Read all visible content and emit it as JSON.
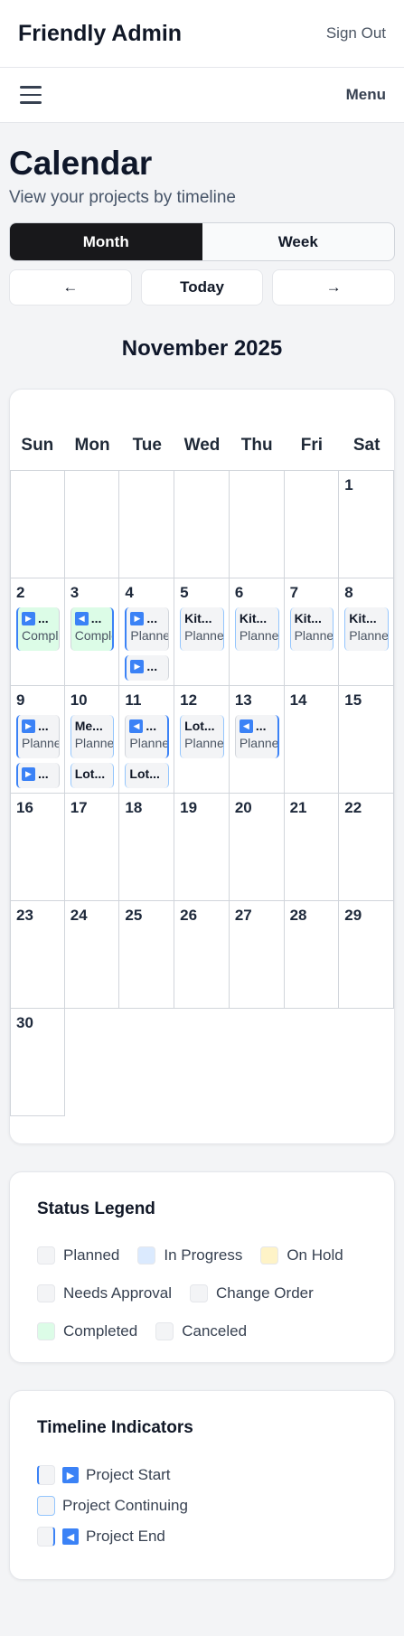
{
  "header": {
    "brand": "Friendly Admin",
    "sign_out": "Sign Out"
  },
  "menubar": {
    "menu_label": "Menu",
    "hamburger_icon": "hamburger-icon"
  },
  "page": {
    "title": "Calendar",
    "subtitle": "View your projects by timeline"
  },
  "view_toggle": {
    "month": "Month",
    "week": "Week",
    "active": "month"
  },
  "nav": {
    "prev": "←",
    "today": "Today",
    "next": "→"
  },
  "calendar": {
    "month_title": "November 2025",
    "weekdays": [
      "Sun",
      "Mon",
      "Tue",
      "Wed",
      "Thu",
      "Fri",
      "Sat"
    ],
    "leading_blank_days": 6,
    "days": [
      {
        "num": "1",
        "events": []
      },
      {
        "num": "2",
        "events": [
          {
            "title": "...",
            "status": "Completed",
            "kind": "start",
            "color": "completed"
          }
        ]
      },
      {
        "num": "3",
        "events": [
          {
            "title": "...",
            "status": "Completed",
            "kind": "end",
            "color": "completed"
          }
        ]
      },
      {
        "num": "4",
        "events": [
          {
            "title": "...",
            "status": "Planned",
            "kind": "start",
            "color": "planned"
          },
          {
            "title": "...",
            "status": "",
            "kind": "start",
            "color": "planned",
            "small": true
          }
        ]
      },
      {
        "num": "5",
        "events": [
          {
            "title": "Kit...",
            "status": "Planned",
            "kind": "cont",
            "color": "planned"
          }
        ]
      },
      {
        "num": "6",
        "events": [
          {
            "title": "Kit...",
            "status": "Planned",
            "kind": "cont",
            "color": "planned"
          }
        ]
      },
      {
        "num": "7",
        "events": [
          {
            "title": "Kit...",
            "status": "Planned",
            "kind": "cont",
            "color": "planned"
          }
        ]
      },
      {
        "num": "8",
        "events": [
          {
            "title": "Kit...",
            "status": "Planned",
            "kind": "cont",
            "color": "planned"
          }
        ]
      },
      {
        "num": "9",
        "events": [
          {
            "title": "...",
            "status": "Planned",
            "kind": "start",
            "color": "planned"
          },
          {
            "title": "...",
            "status": "",
            "kind": "start",
            "color": "planned",
            "small": true
          }
        ]
      },
      {
        "num": "10",
        "events": [
          {
            "title": "Me...",
            "status": "Planned",
            "kind": "cont",
            "color": "planned"
          },
          {
            "title": "Lot...",
            "status": "",
            "kind": "cont",
            "color": "planned",
            "small": true
          }
        ]
      },
      {
        "num": "11",
        "events": [
          {
            "title": "...",
            "status": "Planned",
            "kind": "end",
            "color": "planned"
          },
          {
            "title": "Lot...",
            "status": "",
            "kind": "cont",
            "color": "planned",
            "small": true
          }
        ]
      },
      {
        "num": "12",
        "events": [
          {
            "title": "Lot...",
            "status": "Planned",
            "kind": "cont",
            "color": "planned"
          }
        ]
      },
      {
        "num": "13",
        "events": [
          {
            "title": "...",
            "status": "Planned",
            "kind": "end",
            "color": "planned"
          }
        ]
      },
      {
        "num": "14",
        "events": []
      },
      {
        "num": "15",
        "events": []
      },
      {
        "num": "16",
        "events": []
      },
      {
        "num": "17",
        "events": []
      },
      {
        "num": "18",
        "events": []
      },
      {
        "num": "19",
        "events": []
      },
      {
        "num": "20",
        "events": []
      },
      {
        "num": "21",
        "events": []
      },
      {
        "num": "22",
        "events": []
      },
      {
        "num": "23",
        "events": []
      },
      {
        "num": "24",
        "events": []
      },
      {
        "num": "25",
        "events": []
      },
      {
        "num": "26",
        "events": []
      },
      {
        "num": "27",
        "events": []
      },
      {
        "num": "28",
        "events": []
      },
      {
        "num": "29",
        "events": []
      },
      {
        "num": "30",
        "events": []
      }
    ]
  },
  "legend": {
    "title": "Status Legend",
    "items": [
      {
        "label": "Planned",
        "color": "#f3f4f6"
      },
      {
        "label": "In Progress",
        "color": "#dbeafe"
      },
      {
        "label": "On Hold",
        "color": "#fef3c7"
      },
      {
        "label": "Needs Approval",
        "color": "#f3f4f6"
      },
      {
        "label": "Change Order",
        "color": "#f3f4f6"
      },
      {
        "label": "Completed",
        "color": "#dcfce7"
      },
      {
        "label": "Canceled",
        "color": "#f3f4f6"
      }
    ]
  },
  "timeline": {
    "title": "Timeline Indicators",
    "items": [
      {
        "label": "Project Start",
        "kind": "start",
        "icon": "play-right-icon"
      },
      {
        "label": "Project Continuing",
        "kind": "cont",
        "icon": ""
      },
      {
        "label": "Project End",
        "kind": "end",
        "icon": "play-left-icon"
      }
    ]
  }
}
